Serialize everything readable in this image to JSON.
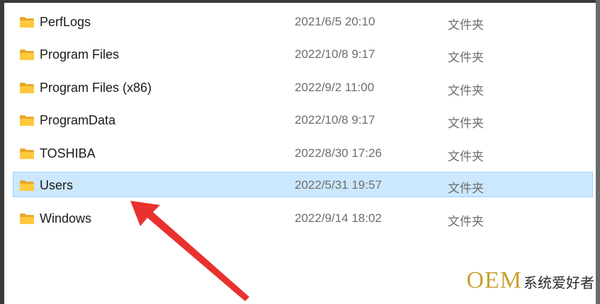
{
  "files": [
    {
      "name": "PerfLogs",
      "date": "2021/6/5 20:10",
      "type": "文件夹",
      "selected": false
    },
    {
      "name": "Program Files",
      "date": "2022/10/8 9:17",
      "type": "文件夹",
      "selected": false
    },
    {
      "name": "Program Files (x86)",
      "date": "2022/9/2 11:00",
      "type": "文件夹",
      "selected": false
    },
    {
      "name": "ProgramData",
      "date": "2022/10/8 9:17",
      "type": "文件夹",
      "selected": false
    },
    {
      "name": "TOSHIBA",
      "date": "2022/8/30 17:26",
      "type": "文件夹",
      "selected": false
    },
    {
      "name": "Users",
      "date": "2022/5/31 19:57",
      "type": "文件夹",
      "selected": true
    },
    {
      "name": "Windows",
      "date": "2022/9/14 18:02",
      "type": "文件夹",
      "selected": false
    }
  ],
  "icons": {
    "folder": "folder-icon"
  },
  "colors": {
    "selection_bg": "#cce8ff",
    "selection_border": "#99d1ff",
    "folder_yellow": "#ffc83d",
    "arrow_red": "#e8322f",
    "watermark_gold": "#c8a233"
  },
  "watermark": {
    "latin": "OEM",
    "cjk": "系统爱好者"
  }
}
